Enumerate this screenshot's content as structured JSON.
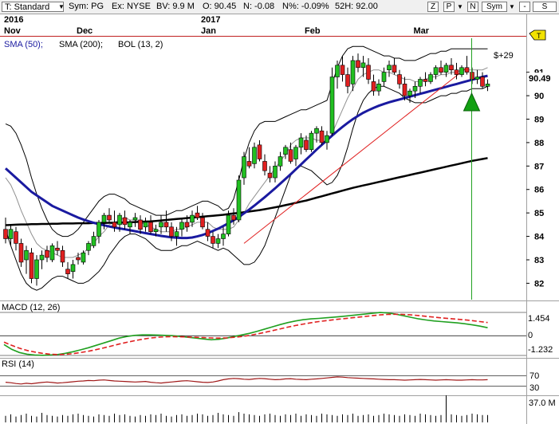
{
  "toolbar": {
    "template": "T: Standard",
    "symbol": "Sym: PG",
    "exchange": "Ex: NYSE",
    "bv": "BV: 9.9 M",
    "open": "O: 90.45",
    "net": "N: -0.08",
    "net_pct": "N%: -0.09%",
    "high52": "52H: 92.00",
    "btn_z": "Z",
    "btn_p": "P",
    "btn_n": "N",
    "btn_sym": "Sym",
    "btn_minus": "-",
    "btn_s": "S"
  },
  "price_panel": {
    "indicators": {
      "sma50": "SMA (50);",
      "sma200": "SMA (200);",
      "bol": "BOL (13, 2)"
    },
    "t_marker": "T",
    "gain_label": "$+29",
    "current_price": "90.49"
  },
  "macd_panel": {
    "title": "MACD (12, 26)",
    "ticks": [
      "1.454",
      "0",
      "-1.232"
    ]
  },
  "rsi_panel": {
    "title": "RSI (14)",
    "ticks": [
      "70",
      "30"
    ]
  },
  "volume_panel": {
    "max_label": "37.0 M"
  },
  "colors": {
    "up": "#21c021",
    "down": "#e02020",
    "sma50": "#1a1aa0",
    "sma200": "#000000",
    "bollinger": "#000000",
    "mid": "#909090",
    "trend": "#e02020",
    "signal": "#20a020",
    "macd": "#20a020",
    "macd_signal": "#e02020",
    "rsi": "#a01818"
  },
  "chart_data": {
    "type": "candlestick",
    "x_axis": {
      "year_labels": [
        {
          "label": "2016",
          "index": 0
        },
        {
          "label": "2017",
          "index": 38
        }
      ],
      "month_labels": [
        {
          "label": "Nov",
          "index": 0
        },
        {
          "label": "Dec",
          "index": 14
        },
        {
          "label": "Jan",
          "index": 38
        },
        {
          "label": "Feb",
          "index": 58
        },
        {
          "label": "Mar",
          "index": 79
        }
      ]
    },
    "y_axis": {
      "ticks": [
        82,
        83,
        84,
        85,
        86,
        87,
        88,
        89,
        90,
        91
      ],
      "range": [
        81.3,
        92.45
      ]
    },
    "candles": [
      [
        84.3,
        84.8,
        83.7,
        83.9
      ],
      [
        83.9,
        84.5,
        83.6,
        84.3
      ],
      [
        84.2,
        84.4,
        83.4,
        83.7
      ],
      [
        83.7,
        83.9,
        82.7,
        82.9
      ],
      [
        83.0,
        83.6,
        82.4,
        83.4
      ],
      [
        83.3,
        83.5,
        82.0,
        82.2
      ],
      [
        82.2,
        83.2,
        81.9,
        83.0
      ],
      [
        83.0,
        83.4,
        82.6,
        83.2
      ],
      [
        83.4,
        83.6,
        82.9,
        83.1
      ],
      [
        83.0,
        83.7,
        82.9,
        83.6
      ],
      [
        83.5,
        83.8,
        83.2,
        83.4
      ],
      [
        83.4,
        83.6,
        82.7,
        82.9
      ],
      [
        82.6,
        82.9,
        82.2,
        82.4
      ],
      [
        82.5,
        83.0,
        82.2,
        82.8
      ],
      [
        83.1,
        83.3,
        82.8,
        83.0
      ],
      [
        82.9,
        83.4,
        82.8,
        83.3
      ],
      [
        83.4,
        83.8,
        83.2,
        83.7
      ],
      [
        83.6,
        84.2,
        83.5,
        84.0
      ],
      [
        84.0,
        84.7,
        83.7,
        84.6
      ],
      [
        84.6,
        85.0,
        84.3,
        84.9
      ],
      [
        84.9,
        85.2,
        84.6,
        84.7
      ],
      [
        84.6,
        85.1,
        84.2,
        84.4
      ],
      [
        84.5,
        85.0,
        84.2,
        84.9
      ],
      [
        84.8,
        85.1,
        84.3,
        84.5
      ],
      [
        84.4,
        84.7,
        84.1,
        84.6
      ],
      [
        84.7,
        85.0,
        84.4,
        84.8
      ],
      [
        84.7,
        84.9,
        84.1,
        84.3
      ],
      [
        84.4,
        84.8,
        84.2,
        84.6
      ],
      [
        84.6,
        84.9,
        84.1,
        84.2
      ],
      [
        84.2,
        84.5,
        84.0,
        84.3
      ],
      [
        84.4,
        84.9,
        84.1,
        84.6
      ],
      [
        84.6,
        85.1,
        84.2,
        84.4
      ],
      [
        84.4,
        84.6,
        83.8,
        84.0
      ],
      [
        84.0,
        84.4,
        83.6,
        84.2
      ],
      [
        84.3,
        84.8,
        84.0,
        84.6
      ],
      [
        84.6,
        84.9,
        84.2,
        84.4
      ],
      [
        84.6,
        85.1,
        84.4,
        84.9
      ],
      [
        85.0,
        85.3,
        84.7,
        84.8
      ],
      [
        84.8,
        85.0,
        84.3,
        84.4
      ],
      [
        84.3,
        84.6,
        83.8,
        84.0
      ],
      [
        84.0,
        84.2,
        83.5,
        83.7
      ],
      [
        83.7,
        84.1,
        83.5,
        83.9
      ],
      [
        83.9,
        84.4,
        83.6,
        84.1
      ],
      [
        84.1,
        85.1,
        84.0,
        84.9
      ],
      [
        84.9,
        85.2,
        84.5,
        84.7
      ],
      [
        84.7,
        86.6,
        84.6,
        86.4
      ],
      [
        86.5,
        87.6,
        86.2,
        87.4
      ],
      [
        87.2,
        87.8,
        86.9,
        87.0
      ],
      [
        87.1,
        88.0,
        86.9,
        87.8
      ],
      [
        87.9,
        88.1,
        87.2,
        87.3
      ],
      [
        87.2,
        87.5,
        86.6,
        86.8
      ],
      [
        86.7,
        87.0,
        86.3,
        86.5
      ],
      [
        86.5,
        87.2,
        86.3,
        87.0
      ],
      [
        87.0,
        87.6,
        86.8,
        87.4
      ],
      [
        87.5,
        87.9,
        87.3,
        87.8
      ],
      [
        87.7,
        88.0,
        87.1,
        87.2
      ],
      [
        87.3,
        87.9,
        87.0,
        87.8
      ],
      [
        87.8,
        88.4,
        87.5,
        88.2
      ],
      [
        88.1,
        88.3,
        87.6,
        87.7
      ],
      [
        87.7,
        88.5,
        87.6,
        88.4
      ],
      [
        88.4,
        88.7,
        88.0,
        88.6
      ],
      [
        88.5,
        88.7,
        87.9,
        88.0
      ],
      [
        88.0,
        88.5,
        87.7,
        88.3
      ],
      [
        88.4,
        91.2,
        88.3,
        90.8
      ],
      [
        90.8,
        91.5,
        90.3,
        91.3
      ],
      [
        91.3,
        91.7,
        90.6,
        90.9
      ],
      [
        90.9,
        91.2,
        90.1,
        90.4
      ],
      [
        90.5,
        91.7,
        90.2,
        91.5
      ],
      [
        91.5,
        91.8,
        91.0,
        91.2
      ],
      [
        91.2,
        91.7,
        90.8,
        91.4
      ],
      [
        91.3,
        91.6,
        90.5,
        90.7
      ],
      [
        90.6,
        90.9,
        90.0,
        90.2
      ],
      [
        90.2,
        90.7,
        90.0,
        90.5
      ],
      [
        90.6,
        91.2,
        90.4,
        91.0
      ],
      [
        91.1,
        91.5,
        90.8,
        91.3
      ],
      [
        91.3,
        91.6,
        90.9,
        91.0
      ],
      [
        90.9,
        91.1,
        90.3,
        90.5
      ],
      [
        90.5,
        90.8,
        89.8,
        90.0
      ],
      [
        90.0,
        90.3,
        89.7,
        90.2
      ],
      [
        90.2,
        90.6,
        89.9,
        90.4
      ],
      [
        90.4,
        90.8,
        90.1,
        90.7
      ],
      [
        90.7,
        91.0,
        90.4,
        90.6
      ],
      [
        90.6,
        91.0,
        90.5,
        90.9
      ],
      [
        90.9,
        91.3,
        90.7,
        91.2
      ],
      [
        91.2,
        91.5,
        90.9,
        91.0
      ],
      [
        91.0,
        91.4,
        90.8,
        91.3
      ],
      [
        91.3,
        91.6,
        90.9,
        91.1
      ],
      [
        91.1,
        91.4,
        90.7,
        90.9
      ],
      [
        90.9,
        91.3,
        90.8,
        91.2
      ],
      [
        91.2,
        91.7,
        90.9,
        91.0
      ],
      [
        91.0,
        91.2,
        90.5,
        90.7
      ],
      [
        90.7,
        91.1,
        90.5,
        90.8
      ],
      [
        90.8,
        91.0,
        90.3,
        90.4
      ],
      [
        90.4,
        90.7,
        90.2,
        90.5
      ]
    ],
    "sma50": [
      86.9,
      86.7,
      86.5,
      86.3,
      86.1,
      85.9,
      85.75,
      85.6,
      85.45,
      85.3,
      85.2,
      85.1,
      85.0,
      84.9,
      84.8,
      84.72,
      84.65,
      84.58,
      84.52,
      84.47,
      84.42,
      84.38,
      84.34,
      84.3,
      84.26,
      84.22,
      84.18,
      84.14,
      84.1,
      84.06,
      84.02,
      83.99,
      83.96,
      83.94,
      83.93,
      83.93,
      83.95,
      84.0,
      84.06,
      84.14,
      84.23,
      84.33,
      84.44,
      84.56,
      84.69,
      84.83,
      84.98,
      85.14,
      85.31,
      85.49,
      85.67,
      85.86,
      86.05,
      86.25,
      86.45,
      86.65,
      86.86,
      87.07,
      87.28,
      87.49,
      87.7,
      87.9,
      88.1,
      88.3,
      88.49,
      88.67,
      88.84,
      89.0,
      89.14,
      89.27,
      89.38,
      89.48,
      89.57,
      89.65,
      89.72,
      89.78,
      89.84,
      89.9,
      89.96,
      90.02,
      90.08,
      90.14,
      90.2,
      90.26,
      90.32,
      90.38,
      90.44,
      90.5,
      90.56,
      90.62,
      90.68,
      90.74,
      90.8,
      90.85
    ],
    "sma200": [
      84.48,
      84.49,
      84.5,
      84.51,
      84.51,
      84.52,
      84.52,
      84.53,
      84.53,
      84.54,
      84.54,
      84.55,
      84.55,
      84.55,
      84.56,
      84.56,
      84.56,
      84.57,
      84.57,
      84.57,
      84.58,
      84.58,
      84.59,
      84.59,
      84.6,
      84.61,
      84.62,
      84.63,
      84.64,
      84.66,
      84.68,
      84.7,
      84.72,
      84.74,
      84.76,
      84.78,
      84.8,
      84.82,
      84.84,
      84.86,
      84.88,
      84.9,
      84.92,
      84.95,
      84.98,
      85.0,
      85.03,
      85.06,
      85.09,
      85.12,
      85.16,
      85.2,
      85.24,
      85.28,
      85.33,
      85.38,
      85.43,
      85.48,
      85.53,
      85.59,
      85.65,
      85.71,
      85.77,
      85.83,
      85.89,
      85.95,
      86.01,
      86.07,
      86.12,
      86.17,
      86.22,
      86.27,
      86.32,
      86.37,
      86.42,
      86.47,
      86.52,
      86.57,
      86.62,
      86.67,
      86.72,
      86.77,
      86.82,
      86.87,
      86.92,
      86.97,
      87.02,
      87.07,
      87.12,
      87.17,
      87.22,
      87.26,
      87.3,
      87.34
    ],
    "bollinger_upper": [
      88.8,
      88.7,
      88.4,
      87.9,
      87.3,
      86.5,
      85.8,
      85.2,
      84.7,
      84.3,
      84.1,
      84.0,
      84.0,
      84.1,
      84.3,
      84.6,
      84.9,
      85.2,
      85.5,
      85.7,
      85.8,
      85.8,
      85.7,
      85.6,
      85.4,
      85.3,
      85.2,
      85.1,
      85.0,
      84.9,
      84.9,
      84.9,
      85.0,
      85.1,
      85.1,
      85.2,
      85.3,
      85.4,
      85.5,
      85.5,
      85.4,
      85.3,
      85.1,
      85.2,
      85.6,
      86.4,
      87.3,
      88.0,
      88.5,
      88.8,
      88.9,
      88.9,
      88.9,
      89.0,
      89.1,
      89.2,
      89.3,
      89.4,
      89.4,
      89.5,
      89.6,
      89.7,
      89.8,
      90.5,
      91.2,
      91.7,
      92.0,
      92.1,
      92.1,
      92.1,
      92.0,
      91.9,
      91.8,
      91.7,
      91.7,
      91.6,
      91.6,
      91.5,
      91.5,
      91.5,
      91.6,
      91.7,
      91.8,
      91.8,
      91.9,
      91.9,
      92.0,
      92.0,
      92.0,
      92.0,
      92.0,
      92.0,
      92.0,
      92.0
    ],
    "bollinger_lower": [
      84.3,
      83.6,
      83.0,
      82.4,
      82.0,
      81.8,
      81.7,
      81.8,
      82.0,
      82.2,
      82.3,
      82.3,
      82.2,
      82.1,
      82.0,
      82.0,
      82.1,
      82.3,
      82.5,
      82.8,
      83.2,
      83.5,
      83.8,
      84.0,
      84.1,
      84.1,
      84.0,
      83.9,
      83.7,
      83.5,
      83.4,
      83.4,
      83.4,
      83.5,
      83.6,
      83.6,
      83.7,
      83.8,
      83.7,
      83.6,
      83.5,
      83.4,
      83.5,
      83.4,
      83.2,
      83.0,
      82.8,
      82.8,
      82.9,
      83.2,
      83.6,
      84.2,
      84.8,
      85.4,
      86.0,
      86.6,
      86.9,
      87.0,
      86.9,
      86.8,
      86.6,
      86.4,
      86.2,
      86.3,
      86.6,
      87.1,
      87.8,
      88.6,
      89.3,
      89.8,
      90.1,
      90.3,
      90.4,
      90.4,
      90.3,
      90.2,
      90.1,
      89.9,
      89.8,
      89.7,
      89.7,
      89.7,
      89.8,
      89.9,
      90.0,
      90.0,
      90.1,
      90.1,
      90.2,
      90.2,
      90.3,
      90.3,
      90.3,
      90.4
    ],
    "bollinger_middle": [
      86.5,
      86.2,
      85.7,
      85.1,
      84.6,
      84.1,
      83.7,
      83.5,
      83.4,
      83.3,
      83.2,
      83.1,
      83.1,
      83.1,
      83.2,
      83.3,
      83.5,
      83.7,
      84.0,
      84.2,
      84.5,
      84.6,
      84.7,
      84.8,
      84.7,
      84.7,
      84.6,
      84.5,
      84.4,
      84.3,
      84.2,
      84.2,
      84.2,
      84.3,
      84.3,
      84.4,
      84.5,
      84.6,
      84.6,
      84.6,
      84.4,
      84.3,
      84.3,
      84.3,
      84.4,
      84.7,
      85.0,
      85.4,
      85.7,
      86.0,
      86.3,
      86.6,
      86.9,
      87.2,
      87.5,
      87.9,
      88.1,
      88.2,
      88.2,
      88.2,
      88.1,
      88.1,
      88.0,
      88.4,
      88.9,
      89.4,
      89.9,
      90.3,
      90.7,
      90.9,
      91.0,
      91.1,
      91.1,
      91.0,
      91.0,
      90.9,
      90.8,
      90.7,
      90.7,
      90.6,
      90.6,
      90.7,
      90.8,
      90.8,
      90.9,
      90.9,
      91.0,
      91.0,
      91.1,
      91.1,
      91.1,
      91.1,
      91.1,
      91.2
    ],
    "trend_line": [
      {
        "x": 46,
        "y": 83.7
      },
      {
        "x": 89,
        "y": 91.2
      }
    ],
    "signal_index": 89,
    "macd": {
      "range": [
        -1.232,
        1.454
      ],
      "macd": [
        -0.55,
        -0.85,
        -1.05,
        -1.15,
        -1.2,
        -1.22,
        -1.2,
        -1.17,
        -1.1,
        -1.0,
        -0.88,
        -0.75,
        -0.6,
        -0.45,
        -0.3,
        -0.15,
        -0.05,
        0.02,
        0.05,
        0.05,
        0.04,
        0.02,
        0.0,
        -0.05,
        -0.1,
        -0.15,
        -0.2,
        -0.25,
        -0.22,
        -0.15,
        -0.05,
        0.05,
        0.15,
        0.28,
        0.42,
        0.56,
        0.7,
        0.82,
        0.92,
        1.0,
        1.05,
        1.08,
        1.12,
        1.16,
        1.2,
        1.25,
        1.3,
        1.35,
        1.4,
        1.45,
        1.42,
        1.35,
        1.25,
        1.15,
        1.05,
        0.98,
        0.92,
        0.88,
        0.84,
        0.8,
        0.75,
        0.68,
        0.6,
        0.5
      ],
      "signal": [
        -0.4,
        -0.6,
        -0.78,
        -0.92,
        -1.02,
        -1.1,
        -1.15,
        -1.17,
        -1.16,
        -1.12,
        -1.05,
        -0.97,
        -0.87,
        -0.76,
        -0.64,
        -0.52,
        -0.41,
        -0.31,
        -0.22,
        -0.15,
        -0.1,
        -0.07,
        -0.06,
        -0.07,
        -0.08,
        -0.1,
        -0.12,
        -0.14,
        -0.15,
        -0.14,
        -0.1,
        -0.05,
        0.02,
        0.11,
        0.21,
        0.32,
        0.43,
        0.54,
        0.64,
        0.73,
        0.81,
        0.88,
        0.94,
        1.0,
        1.05,
        1.1,
        1.15,
        1.2,
        1.25,
        1.3,
        1.33,
        1.34,
        1.33,
        1.3,
        1.26,
        1.21,
        1.16,
        1.11,
        1.07,
        1.03,
        0.99,
        0.94,
        0.88,
        0.82
      ]
    },
    "rsi": {
      "range": [
        0,
        100
      ],
      "values": [
        45,
        43,
        40,
        38,
        41,
        39,
        42,
        44,
        46,
        44,
        42,
        43,
        45,
        47,
        49,
        50,
        52,
        51,
        53,
        54,
        52,
        50,
        49,
        48,
        47,
        46,
        47,
        48,
        45,
        43,
        42,
        44,
        46,
        48,
        50,
        51,
        49,
        47,
        45,
        44,
        46,
        50,
        55,
        58,
        60,
        59,
        57,
        56,
        58,
        60,
        59,
        57,
        55,
        56,
        58,
        59,
        57,
        56,
        55,
        57,
        58,
        60,
        62,
        64,
        66,
        65,
        63,
        62,
        61,
        60,
        59,
        58,
        57,
        56,
        55,
        55,
        54,
        53,
        54,
        55,
        56,
        55,
        54,
        53,
        54,
        55,
        54,
        53,
        53,
        54,
        55,
        54,
        54,
        55
      ]
    },
    "volume": {
      "max": 37.0,
      "values": [
        9,
        11,
        8,
        10,
        12,
        9,
        8,
        13,
        10,
        9,
        8,
        10,
        9,
        11,
        12,
        10,
        9,
        8,
        11,
        10,
        9,
        12,
        10,
        11,
        9,
        8,
        10,
        9,
        11,
        10,
        12,
        9,
        8,
        10,
        11,
        9,
        10,
        12,
        11,
        9,
        10,
        13,
        11,
        10,
        9,
        14,
        12,
        11,
        10,
        9,
        11,
        12,
        10,
        9,
        11,
        10,
        12,
        9,
        11,
        10,
        9,
        12,
        11,
        10,
        9,
        11,
        10,
        12,
        9,
        10,
        11,
        9,
        10,
        12,
        11,
        10,
        9,
        11,
        10,
        9,
        12,
        11,
        10,
        9,
        10,
        37,
        11,
        10,
        9,
        10,
        12,
        11,
        10,
        10
      ]
    }
  }
}
